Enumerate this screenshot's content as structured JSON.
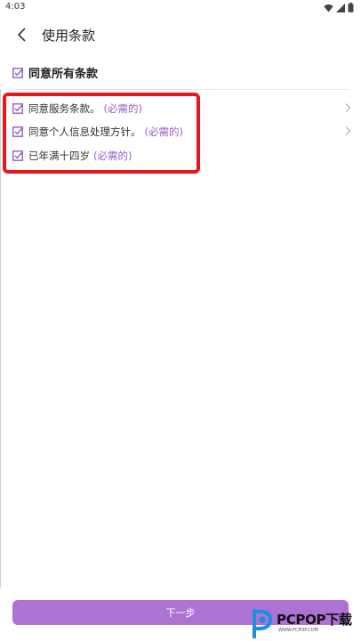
{
  "status_bar": {
    "time": "4:03",
    "icons": [
      "wifi-icon",
      "signal-icon",
      "battery-icon"
    ]
  },
  "header": {
    "back_icon": "chevron-left-icon",
    "title": "使用条款"
  },
  "agree_all": {
    "label": "同意所有条款",
    "checked": true
  },
  "terms": [
    {
      "label": "同意服务条款。",
      "required": "(必需的)",
      "checked": true,
      "has_arrow": true
    },
    {
      "label": "同意个人信息处理方针。",
      "required": "(必需的)",
      "checked": true,
      "has_arrow": true
    },
    {
      "label": "已年满十四岁",
      "required": "(必需的)",
      "checked": true,
      "has_arrow": false
    }
  ],
  "next_button": {
    "label": "下一步"
  },
  "watermark": {
    "text": "PCPOP下载",
    "sub": "WWW.PCPOP.COM"
  },
  "colors": {
    "accent": "#ac72d4",
    "checkbox": "#8e4fc0",
    "highlight": "#e8161b"
  }
}
